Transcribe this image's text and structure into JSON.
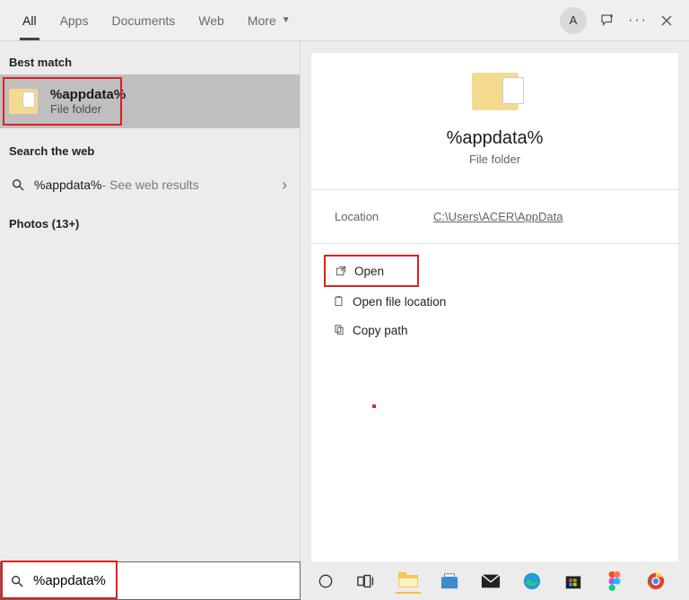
{
  "tabs": {
    "all": "All",
    "apps": "Apps",
    "documents": "Documents",
    "web": "Web",
    "more": "More"
  },
  "top_right": {
    "avatar_letter": "A"
  },
  "sections": {
    "best_match": "Best match",
    "search_web": "Search the web",
    "photos": "Photos (13+)"
  },
  "best_match": {
    "title": "%appdata%",
    "subtitle": "File folder"
  },
  "web": {
    "query": "%appdata%",
    "suffix": " - See web results"
  },
  "detail": {
    "title": "%appdata%",
    "subtitle": "File folder",
    "location_label": "Location",
    "location_path": "C:\\Users\\ACER\\AppData",
    "actions": {
      "open": "Open",
      "open_loc": "Open file location",
      "copy_path": "Copy path"
    }
  },
  "searchbox": {
    "value": "%appdata%"
  }
}
